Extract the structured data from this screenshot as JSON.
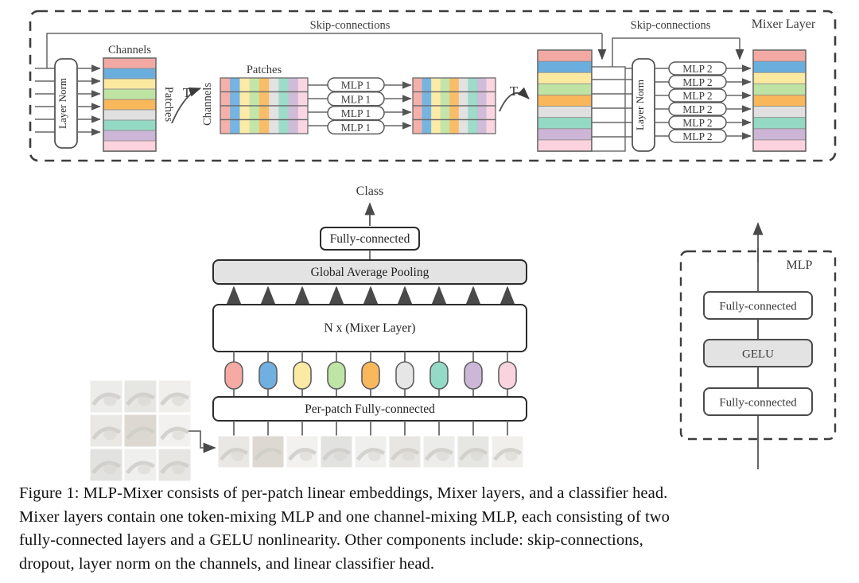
{
  "figure": {
    "number": "Figure 1",
    "caption_lines": [
      "Figure 1: MLP-Mixer consists of per-patch linear embeddings, Mixer layers, and a classifier head.",
      "Mixer layers contain one token-mixing MLP and one channel-mixing MLP, each consisting of two",
      "fully-connected layers and a GELU nonlinearity.  Other components include:  skip-connections,",
      "dropout, layer norm on the channels, and linear classifier head."
    ]
  },
  "mixer_layer": {
    "title": "Mixer Layer",
    "skip_left_label": "Skip-connections",
    "skip_right_label": "Skip-connections",
    "layer_norm_1": "Layer Norm",
    "layer_norm_2": "Layer Norm",
    "channels_label_1": "Channels",
    "patches_label_1": "Patches",
    "patches_label_2": "Patches",
    "channels_label_2": "Channels",
    "transpose_1": "T",
    "transpose_2": "T",
    "mlp1_label": "MLP 1",
    "mlp1_count": 4,
    "mlp2_label": "MLP 2",
    "mlp2_count": 6,
    "layer_norm_input_lines": 6,
    "stack_colors": [
      "#f3a9a3",
      "#6aaede",
      "#fbe9a0",
      "#bfe3a2",
      "#f8b75b",
      "#e0e0e0",
      "#94d9c4",
      "#ccb5d6",
      "#fbd2dd"
    ],
    "row_count_transposed": 4
  },
  "architecture": {
    "class_label": "Class",
    "head_fc_label": "Fully-connected",
    "gap_label": "Global Average Pooling",
    "mixer_label": "N x (Mixer Layer)",
    "per_patch_label": "Per-patch Fully-connected",
    "token_count": 9,
    "token_colors": [
      "#f5aaa4",
      "#6fb0e0",
      "#fbeaa4",
      "#bfe5a4",
      "#f9b85c",
      "#e6e6e6",
      "#93dbc6",
      "#cdb7d8",
      "#f9d4de"
    ],
    "gap_arrow_count": 9,
    "patch_grid_rows": 3,
    "patch_grid_cols": 3,
    "patch_strip_count": 9
  },
  "mlp_detail": {
    "title": "MLP",
    "blocks": [
      {
        "label": "Fully-connected",
        "filled": false
      },
      {
        "label": "GELU",
        "filled": true
      },
      {
        "label": "Fully-connected",
        "filled": false
      }
    ]
  },
  "colors": {
    "stroke": "#5a5a5a",
    "dark_stroke": "#333333",
    "fill_gray": "#e3e3e3",
    "background": "#ffffff"
  }
}
